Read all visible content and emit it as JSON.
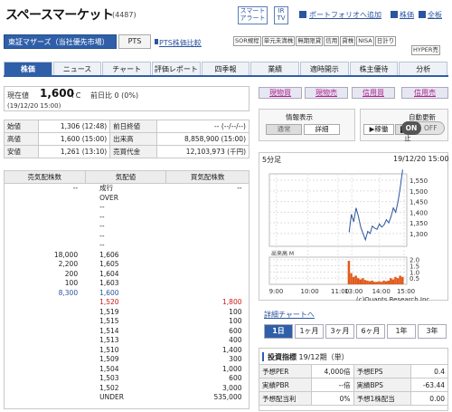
{
  "header": {
    "title": "スペースマーケット",
    "code": "(4487)",
    "smart_alert": "スマート\nアラート",
    "irtv": "IR\nTV",
    "portfolio_add": "ポートフォリオへ追加",
    "stock_price": "株価",
    "all_boards": "全板"
  },
  "market": {
    "label": "東証マザーズ（当社優先市場）",
    "pts": "PTS",
    "pts_compare": "PTS株価比較",
    "badges": [
      "SOR規程",
      "単元未満株",
      "無期限貸",
      "信用",
      "貸株",
      "NISA",
      "日計り"
    ],
    "hyper": "HYPER売"
  },
  "tabs": [
    "株価",
    "ニュース",
    "チャート",
    "評価レポート",
    "四季報",
    "業績",
    "適時開示",
    "株主優待",
    "分析"
  ],
  "price": {
    "label": "現在値",
    "value": "1,600",
    "unit": "↑C",
    "change_label": "前日比",
    "change": "0 (0%)",
    "time": "(19/12/20 15:00)"
  },
  "trade_buttons": [
    "現物買",
    "現物売",
    "信用買",
    "信用売"
  ],
  "stats": [
    [
      "始値",
      "1,306",
      "(12:48)",
      "前日終値",
      "--",
      "(--/--/--)"
    ],
    [
      "高値",
      "1,600",
      "(15:00)",
      "出来高",
      "8,858,900",
      "(15:00)"
    ],
    [
      "安値",
      "1,261",
      "(13:10)",
      "売買代金",
      "12,103,973",
      "(千円)"
    ]
  ],
  "info_panel": {
    "title": "情報表示",
    "normal": "通常",
    "detail": "詳細"
  },
  "auto_panel": {
    "title": "自動更新",
    "running": "稼働",
    "stop": "停止",
    "on": "ON",
    "off": "OFF"
  },
  "orderbook": {
    "headers": [
      "売気配株数",
      "気配値",
      "買気配株数"
    ],
    "rows": [
      [
        "--",
        "成行",
        "--"
      ],
      [
        "",
        "OVER",
        ""
      ],
      [
        "",
        "--",
        ""
      ],
      [
        "",
        "--",
        ""
      ],
      [
        "",
        "--",
        ""
      ],
      [
        "",
        "--",
        ""
      ],
      [
        "",
        "--",
        ""
      ],
      [
        "18,000",
        "1,606",
        ""
      ],
      [
        "2,200",
        "1,605",
        ""
      ],
      [
        "200",
        "1,604",
        ""
      ],
      [
        "100",
        "1,603",
        ""
      ],
      [
        "8,300",
        "1,600",
        ""
      ],
      [
        "",
        "1,520",
        "1,800"
      ],
      [
        "",
        "1,519",
        "100"
      ],
      [
        "",
        "1,515",
        "100"
      ],
      [
        "",
        "1,514",
        "600"
      ],
      [
        "",
        "1,513",
        "400"
      ],
      [
        "",
        "1,510",
        "1,400"
      ],
      [
        "",
        "1,509",
        "300"
      ],
      [
        "",
        "1,504",
        "1,000"
      ],
      [
        "",
        "1,503",
        "600"
      ],
      [
        "",
        "1,502",
        "3,000"
      ],
      [
        "",
        "UNDER",
        "535,000"
      ]
    ]
  },
  "chart_data": {
    "type": "line",
    "period_label": "5分足",
    "timestamp": "19/12/20 15:00",
    "y_ticks": [
      "1,550",
      "1,500",
      "1,450",
      "1,400",
      "1,350",
      "1,300"
    ],
    "x_ticks": [
      "9:00",
      "10:00",
      "11:00",
      "13:00",
      "14:00",
      "15:00"
    ],
    "volume_label": "出来高 M",
    "volume_ticks": [
      "2.0",
      "1.5",
      "1.0",
      "0.5"
    ],
    "credit": "(c)Quants Research Inc.",
    "ylim": [
      1261,
      1600
    ],
    "price": [
      1306,
      1390,
      1355,
      1420,
      1380,
      1330,
      1300,
      1270,
      1310,
      1300,
      1335,
      1325,
      1320,
      1345,
      1330,
      1340,
      1365,
      1350,
      1380,
      1420,
      1400,
      1450,
      1520,
      1600
    ],
    "volume": [
      1.9,
      0.9,
      0.6,
      0.7,
      0.5,
      0.4,
      0.5,
      0.35,
      0.3,
      0.25,
      0.3,
      0.2,
      0.2,
      0.25,
      0.2,
      0.3,
      0.25,
      0.3,
      0.5,
      0.4,
      0.6,
      0.5,
      0.7,
      0.6
    ],
    "line_color": "#2b55a0",
    "volume_color": "#e05a1a"
  },
  "links": {
    "detail_chart": "詳細チャートへ"
  },
  "periods": [
    "1日",
    "1ヶ月",
    "3ヶ月",
    "6ヶ月",
    "1年",
    "3年"
  ],
  "indicators": {
    "title": "投資指標",
    "subtitle": "19/12期（単）",
    "rows": [
      [
        "予想PER",
        "4,000倍",
        "予想EPS",
        "0.4"
      ],
      [
        "実績PBR",
        "--倍",
        "実績BPS",
        "-63.44"
      ],
      [
        "予想配当利",
        "0%",
        "予想1株配当",
        "0.00"
      ]
    ]
  }
}
